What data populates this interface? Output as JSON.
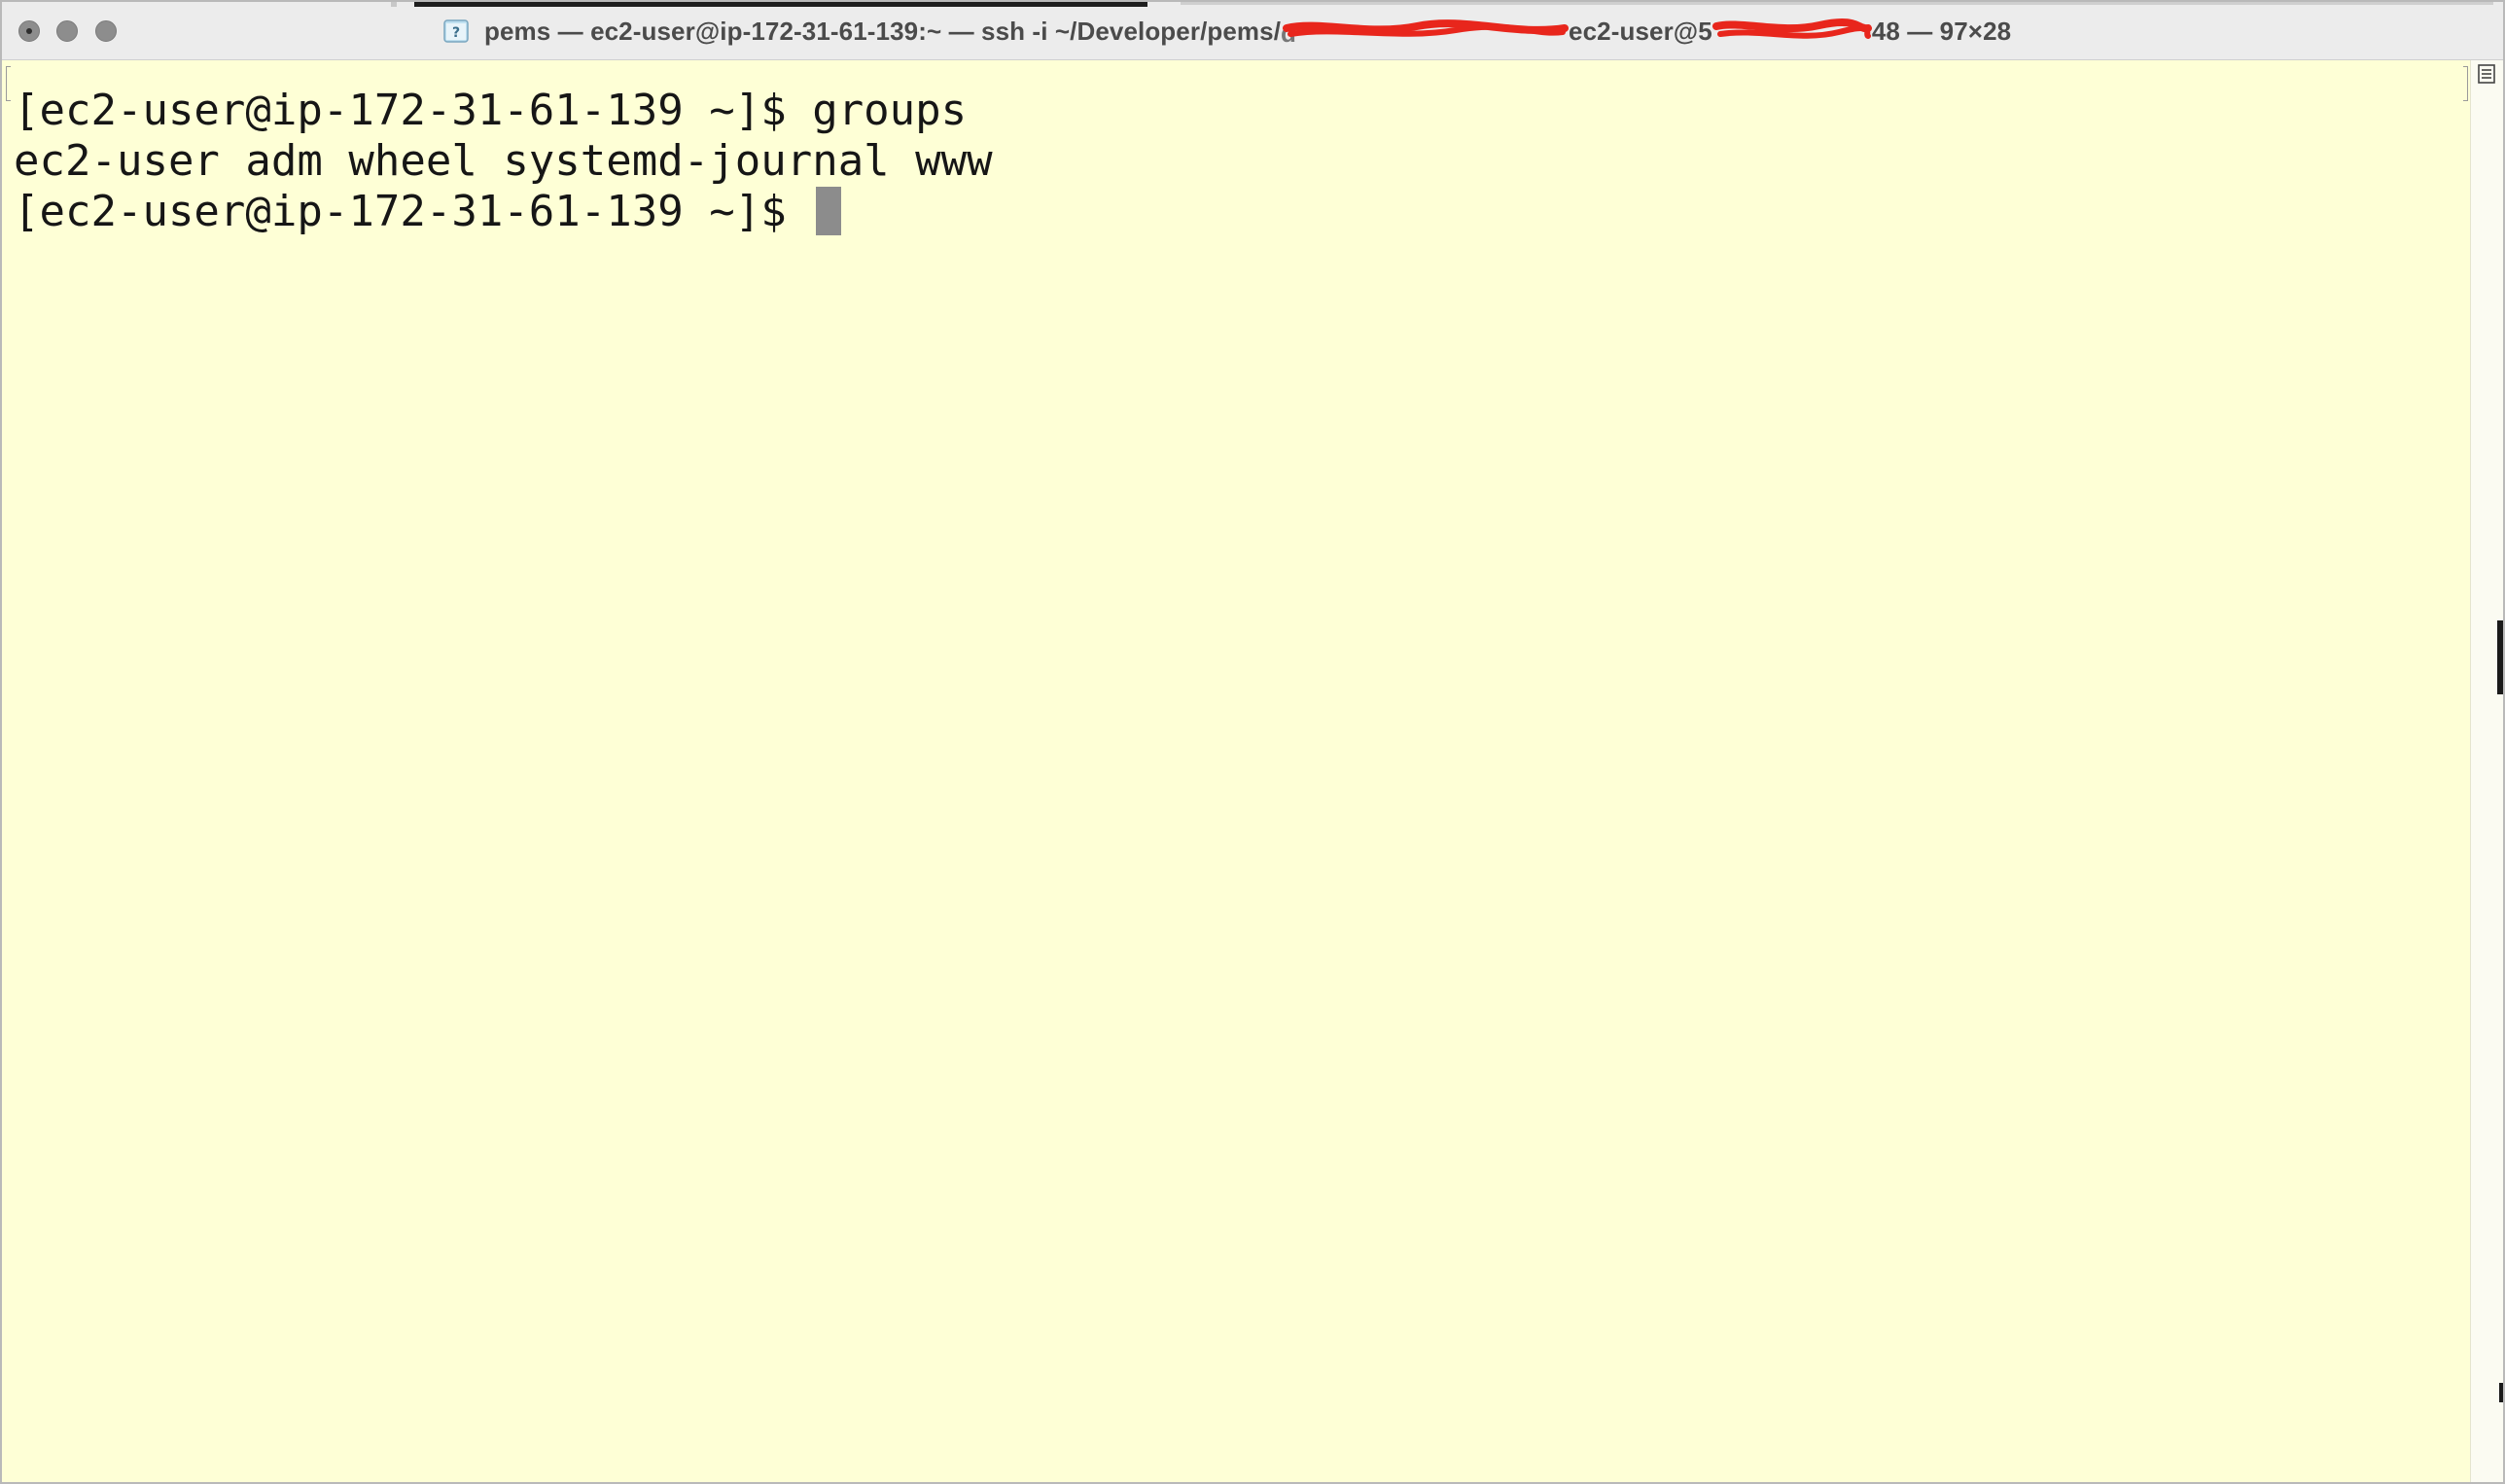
{
  "window": {
    "title_part1": "pems — ec2-user@ip-172-31-61-139:~ — ssh -i ~/Developer/pems/",
    "title_part2": " ec2-user@5",
    "title_part3": "48 — 97×28",
    "title_icon": "terminal-profile-icon",
    "background_color": "#FEFFD6",
    "redaction_color": "#E8261C"
  },
  "terminal": {
    "lines": [
      "[ec2-user@ip-172-31-61-139 ~]$ groups",
      "ec2-user adm wheel systemd-journal www",
      "[ec2-user@ip-172-31-61-139 ~]$ "
    ]
  },
  "controls": {
    "close": "close-button",
    "minimize": "minimize-button",
    "zoom": "zoom-button"
  }
}
